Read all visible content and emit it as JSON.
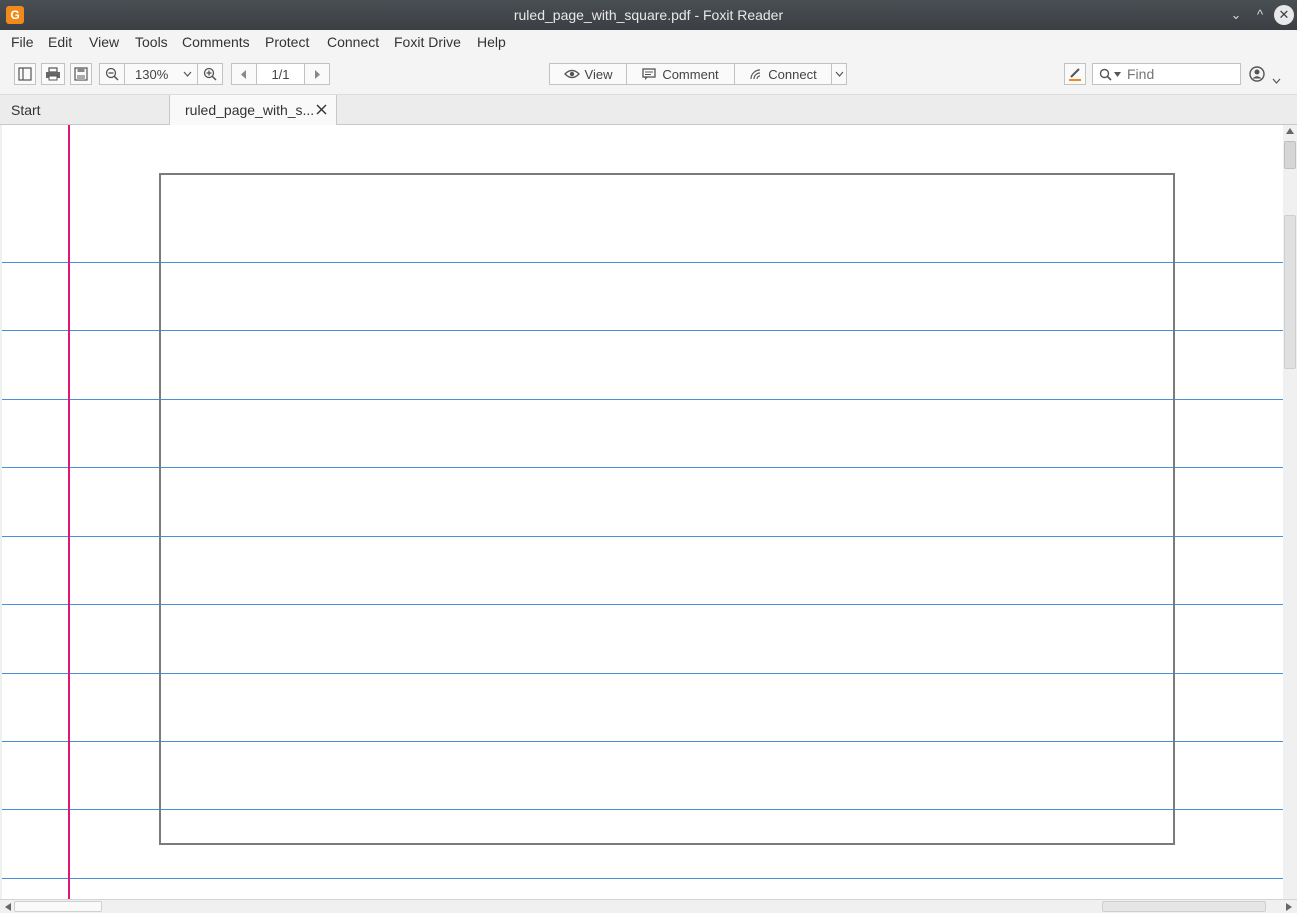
{
  "window": {
    "title": "ruled_page_with_square.pdf - Foxit Reader",
    "app_icon_glyph": "G",
    "minimize_glyph": "⌄",
    "maximize_glyph": "^",
    "close_glyph": "✕"
  },
  "menu": {
    "items": [
      "File",
      "Edit",
      "View",
      "Tools",
      "Comments",
      "Protect",
      "Connect",
      "Foxit Drive",
      "Help"
    ]
  },
  "toolbar": {
    "zoom_value": "130%",
    "page_value": "1/1",
    "view_label": "View",
    "comment_label": "Comment",
    "connect_label": "Connect",
    "find_placeholder": "Find"
  },
  "tabs": [
    {
      "label": "Start",
      "active": false
    },
    {
      "label": "ruled_page_with_s...",
      "active": true
    }
  ],
  "colors": {
    "rule_line": "#4a90d9",
    "margin_line": "#e0157a",
    "square_border": "#7b7b7b",
    "app_icon": "#f08a1c"
  },
  "icons": {
    "panel": "sidebar-toggle-icon",
    "print": "print-icon",
    "save": "save-icon",
    "zoom_out": "zoom-out-icon",
    "zoom_in": "zoom-in-icon",
    "highlight": "highlighter-icon",
    "search": "search-icon",
    "account": "account-icon"
  }
}
